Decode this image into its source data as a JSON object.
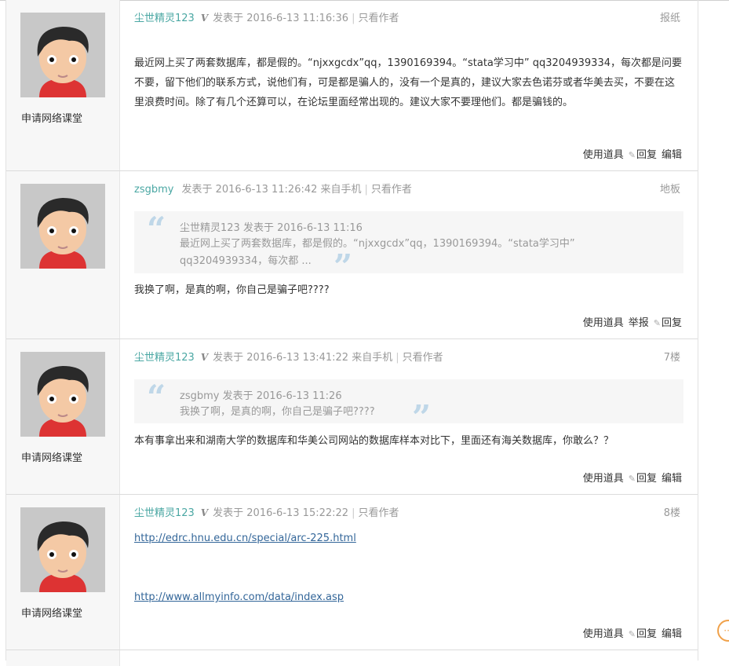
{
  "posts": [
    {
      "author": "尘世精灵123",
      "vip": "V",
      "posted": "发表于 2016-6-13 11:16:36",
      "only_author": "只看作者",
      "floor": "报纸",
      "side_name": "申请网络课堂",
      "content": "最近网上买了两套数据库，都是假的。“njxxgcdx”qq，1390169394。“stata学习中” qq3204939334，每次都是问要不要，留下他们的联系方式，说他们有，可是都是骗人的，没有一个是真的，建议大家去色诺芬或者华美去买，不要在这里浪费时间。除了有几个还算可以，在论坛里面经常出现的。建议大家不要理他们。都是骗钱的。",
      "actions": [
        "使用道具",
        "回复",
        "编辑"
      ]
    },
    {
      "author": "zsgbmy",
      "posted": "发表于 2016-6-13 11:26:42 来自手机",
      "only_author": "只看作者",
      "floor": "地板",
      "quote_head": "尘世精灵123 发表于 2016-6-13 11:16",
      "quote_text": "最近网上买了两套数据库，都是假的。“njxxgcdx”qq，1390169394。“stata学习中” qq3204939334，每次都 ...",
      "content": "我换了啊，是真的啊，你自己是骗子吧????",
      "actions": [
        "使用道具",
        "举报",
        "回复"
      ]
    },
    {
      "author": "尘世精灵123",
      "vip": "V",
      "posted": "发表于 2016-6-13 13:41:22 来自手机",
      "only_author": "只看作者",
      "floor": "7楼",
      "side_name": "申请网络课堂",
      "quote_head": "zsgbmy 发表于 2016-6-13 11:26",
      "quote_text": "我换了啊，是真的啊，你自己是骗子吧????",
      "content": "本有事拿出来和湖南大学的数据库和华美公司网站的数据库样本对比下，里面还有海关数据库，你敢么？？",
      "actions": [
        "使用道具",
        "回复",
        "编辑"
      ]
    },
    {
      "author": "尘世精灵123",
      "vip": "V",
      "posted": "发表于 2016-6-13 15:22:22",
      "only_author": "只看作者",
      "floor": "8楼",
      "side_name": "申请网络课堂",
      "link1": "http://edrc.hnu.edu.cn/special/arc-225.html",
      "link2": "http://www.allmyinfo.com/data/index.asp",
      "actions": [
        "使用道具",
        "回复",
        "编辑"
      ]
    }
  ],
  "help_icon": "chat-bubble-icon"
}
